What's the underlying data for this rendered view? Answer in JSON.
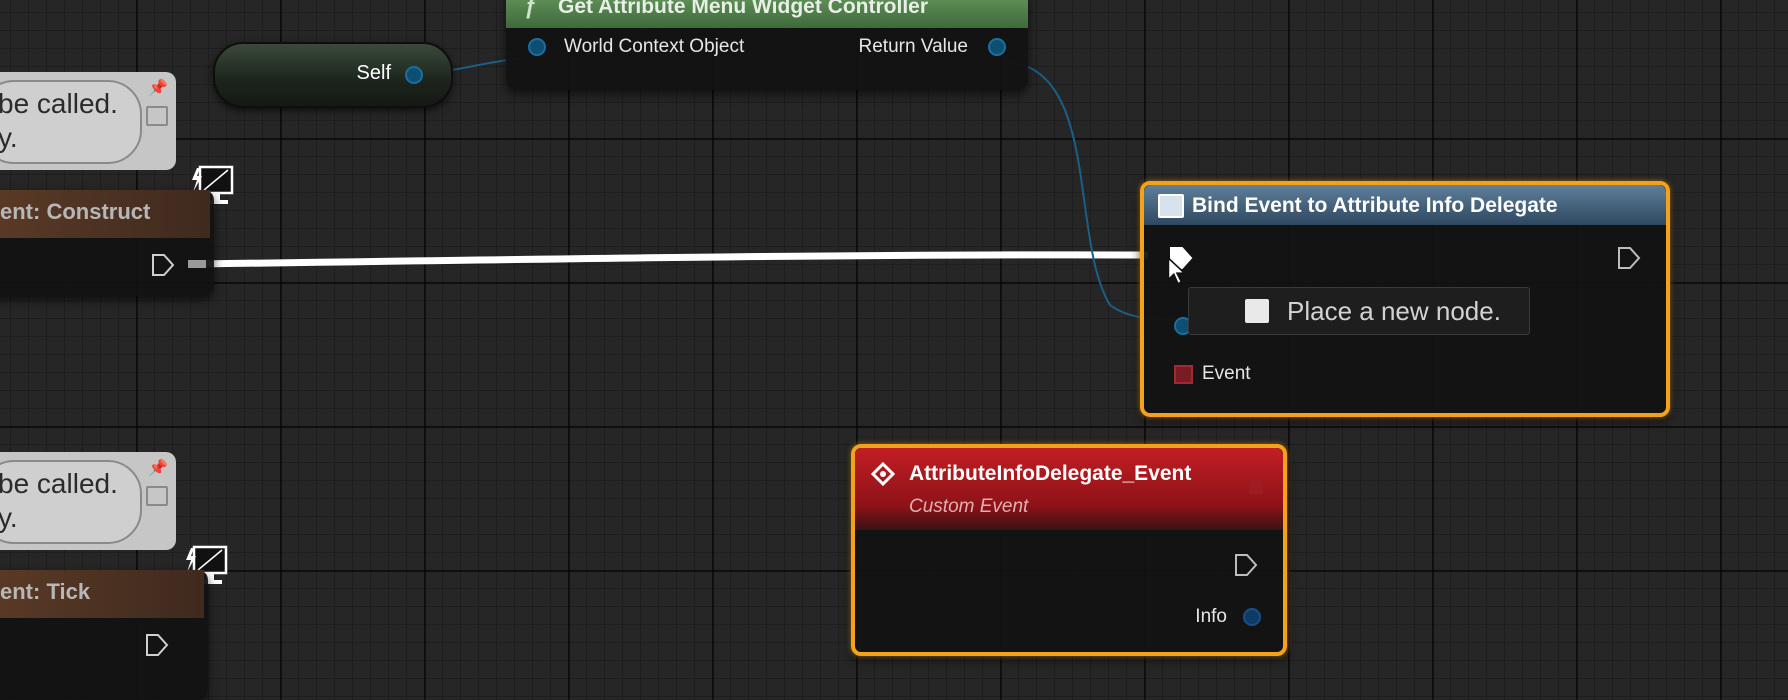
{
  "graph": {
    "self_node": {
      "label": "Self"
    },
    "get_controller_node": {
      "title": "Get Attribute Menu Widget Controller",
      "input_pin": "World Context Object",
      "output_pin": "Return Value"
    },
    "left_comment_top": {
      "line1": "be called.",
      "line2": "y."
    },
    "left_comment_bottom": {
      "line1": "be called.",
      "line2": "y."
    },
    "event_construct": {
      "title": "ent: Construct"
    },
    "event_tick": {
      "title": "ent: Tick"
    },
    "bind_event_node": {
      "title": "Bind Event to Attribute Info Delegate",
      "event_pin": "Event"
    },
    "tooltip": {
      "text": "Place a new node."
    },
    "custom_event_node": {
      "title": "AttributeInfoDelegate_Event",
      "subtitle": "Custom Event",
      "output_pin": "Info"
    }
  },
  "colors": {
    "selection_outline": "#f3a21a",
    "function_header": "#4f7d4a",
    "bind_header": "#3e5d78",
    "custom_event_header": "#b0151a",
    "object_pin": "#1a6ea0",
    "exec_wire": "#ffffff"
  },
  "icons": [
    "function-icon",
    "monitor-lightning-icon",
    "pin-icon",
    "delegate-icon",
    "event-diamond-icon",
    "mouse-cursor-icon"
  ]
}
